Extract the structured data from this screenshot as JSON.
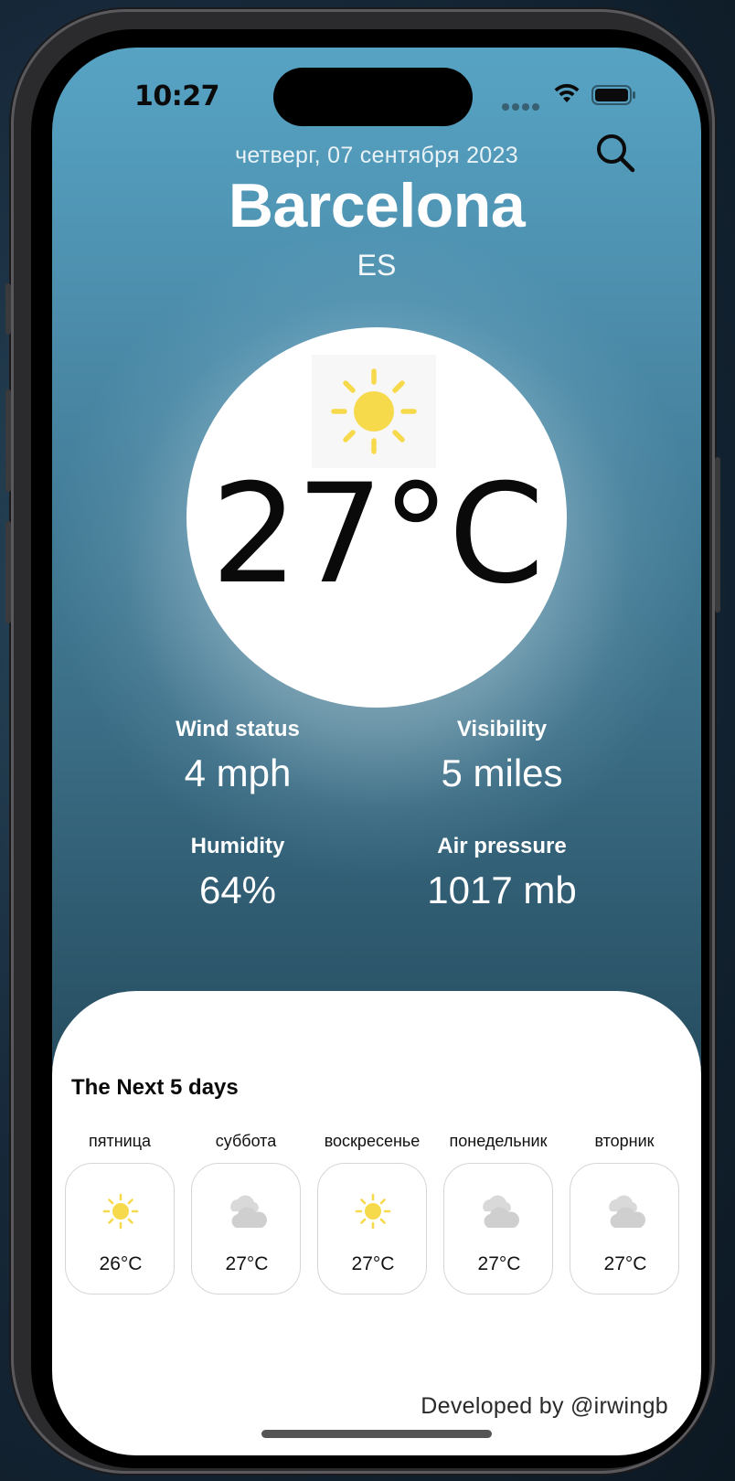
{
  "status_bar": {
    "time": "10:27"
  },
  "header": {
    "date": "четверг, 07 сентября 2023",
    "city": "Barcelona",
    "country": "ES",
    "search_icon": "search-icon"
  },
  "current": {
    "icon": "sun-icon",
    "temperature": "27°C"
  },
  "stats": [
    {
      "label": "Wind status",
      "value": "4 mph"
    },
    {
      "label": "Visibility",
      "value": "5 miles"
    },
    {
      "label": "Humidity",
      "value": "64%"
    },
    {
      "label": "Air pressure",
      "value": "1017 mb"
    }
  ],
  "forecast": {
    "title": "The Next 5 days",
    "days": [
      {
        "name": "пятница",
        "icon": "sun-icon",
        "temp": "26°C"
      },
      {
        "name": "суббота",
        "icon": "cloud-icon",
        "temp": "27°C"
      },
      {
        "name": "воскресенье",
        "icon": "sun-icon",
        "temp": "27°C"
      },
      {
        "name": "понедельник",
        "icon": "cloud-icon",
        "temp": "27°C"
      },
      {
        "name": "вторник",
        "icon": "cloud-icon",
        "temp": "27°C"
      }
    ]
  },
  "footer": {
    "credit": "Developed by @irwingb"
  },
  "colors": {
    "sun": "#f7d94c",
    "cloud": "#d4d4d4",
    "sky_top": "#57a3c4",
    "sky_bottom": "#22485a"
  }
}
